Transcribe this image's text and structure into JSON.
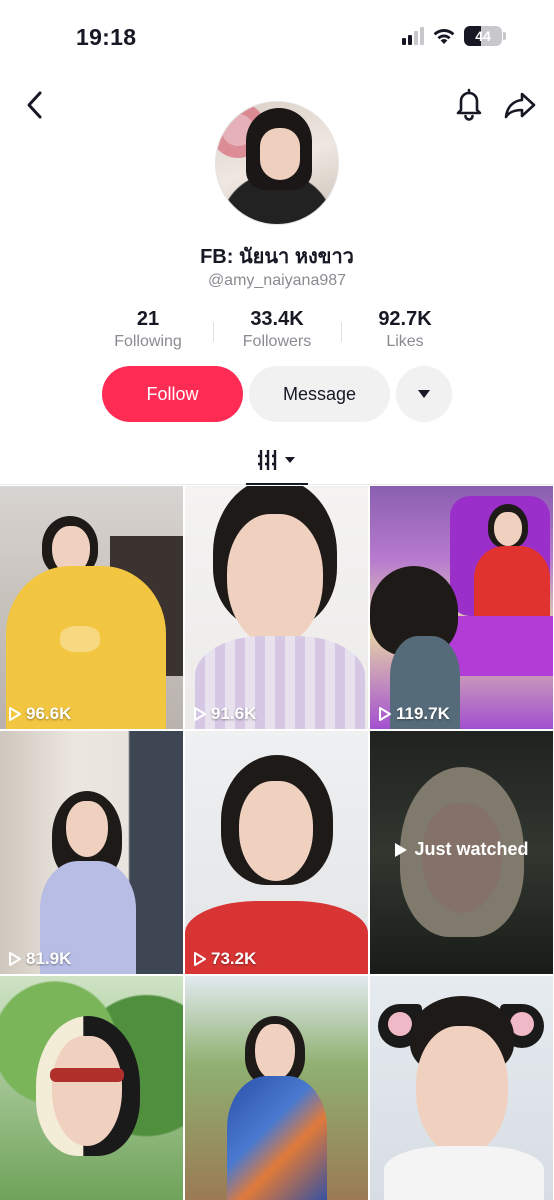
{
  "status_bar": {
    "time": "19:18",
    "battery": "44"
  },
  "profile": {
    "display_name": "FB: นัยนา หงขาว",
    "username": "@amy_naiyana987"
  },
  "stats": [
    {
      "value": "21",
      "label": "Following"
    },
    {
      "value": "33.4K",
      "label": "Followers"
    },
    {
      "value": "92.7K",
      "label": "Likes"
    }
  ],
  "actions": {
    "follow_label": "Follow",
    "message_label": "Message"
  },
  "tab_icon": "video-grid-icon",
  "videos": [
    {
      "views": "96.6K"
    },
    {
      "views": "91.6K"
    },
    {
      "views": "119.7K"
    },
    {
      "views": "81.9K"
    },
    {
      "views": "73.2K"
    },
    {
      "overlay": "Just watched"
    },
    {
      "views": ""
    },
    {
      "views": ""
    },
    {
      "views": ""
    }
  ],
  "colors": {
    "accent": "#fe2c55",
    "secondary_button": "#f1f1f2",
    "muted_text": "#8a8b91"
  }
}
